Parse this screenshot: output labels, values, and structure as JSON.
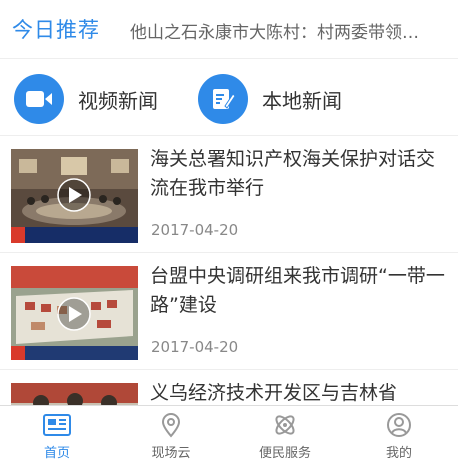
{
  "header": {
    "section_title": "今日推荐",
    "ticker_text": "他山之石永康市大陈村：村两委带领…"
  },
  "quick_entries": {
    "video_label": "视频新闻",
    "local_label": "本地新闻"
  },
  "news": [
    {
      "title": "海关总署知识产权海关保护对话交流在我市举行",
      "date": "2017-04-20",
      "thumb_caption_1": "海关总署知识产权海关保护对话交流在我市举行"
    },
    {
      "title": "台盟中央调研组来我市调研“一带一路”建设",
      "date": "2017-04-20",
      "thumb_caption_1": "台盟中央调研组来我市调研“一带一路”建设"
    },
    {
      "title": "义乌经济技术开发区与吉林省",
      "date": ""
    }
  ],
  "tabbar": {
    "tabs": [
      {
        "label": "首页",
        "active": true
      },
      {
        "label": "现场云",
        "active": false
      },
      {
        "label": "便民服务",
        "active": false
      },
      {
        "label": "我的",
        "active": false
      }
    ]
  },
  "colors": {
    "accent": "#2f8ae8",
    "text_primary": "#333333",
    "text_secondary": "#888888"
  }
}
